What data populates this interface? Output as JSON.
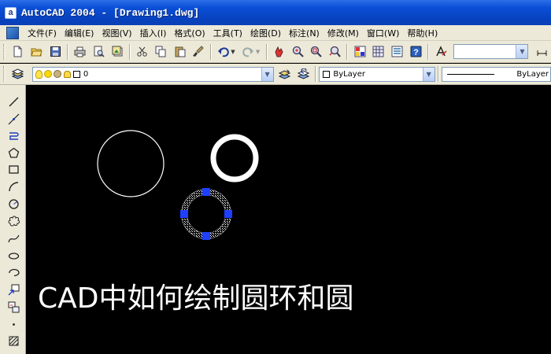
{
  "window": {
    "app_icon_letter": "a",
    "title": "AutoCAD 2004 - [Drawing1.dwg]"
  },
  "menu": {
    "items": [
      {
        "label": "文件(F)"
      },
      {
        "label": "编辑(E)"
      },
      {
        "label": "视图(V)"
      },
      {
        "label": "插入(I)"
      },
      {
        "label": "格式(O)"
      },
      {
        "label": "工具(T)"
      },
      {
        "label": "绘图(D)"
      },
      {
        "label": "标注(N)"
      },
      {
        "label": "修改(M)"
      },
      {
        "label": "窗口(W)"
      },
      {
        "label": "帮助(H)"
      }
    ]
  },
  "layers_toolbar": {
    "layer_name": "0",
    "color_value": "ByLayer",
    "linetype_value": "ByLayer"
  },
  "canvas": {
    "background": "#000000",
    "caption": "CAD中如何绘制圆环和圆",
    "objects": [
      {
        "type": "circle",
        "style": "thin white outline"
      },
      {
        "type": "donut",
        "style": "thick white ring"
      },
      {
        "type": "donut",
        "style": "selected, hatched with blue grips",
        "grip_color": "#1f3fff"
      }
    ]
  },
  "colors": {
    "titlebar": "#0a4fd6",
    "chrome": "#ece9d8",
    "grip": "#1f3fff"
  }
}
